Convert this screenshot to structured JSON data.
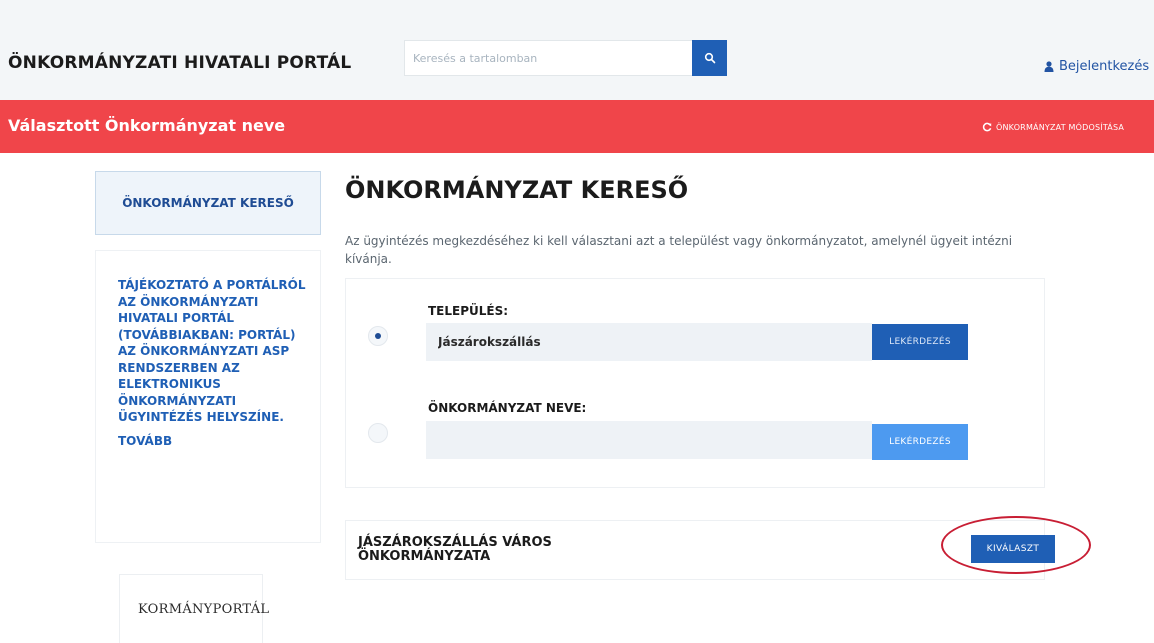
{
  "header": {
    "portal_title": "ÖNKORMÁNYZATI HIVATALI PORTÁL",
    "search_placeholder": "Keresés a tartalomban",
    "login_label": "Bejelentkezés"
  },
  "banner": {
    "title": "Választott Önkormányzat neve",
    "change_link": "ÖNKORMÁNYZAT MÓDOSÍTÁSA"
  },
  "sidebar": {
    "active_item": "ÖNKORMÁNYZAT KERESŐ",
    "info_text": "TÁJÉKOZTATÓ A PORTÁLRÓL AZ ÖNKORMÁNYZATI HIVATALI PORTÁL (TOVÁBBIAKBAN: PORTÁL) AZ ÖNKORMÁNYZATI ASP RENDSZERBEN AZ ELEKTRONIKUS ÖNKORMÁNYZATI ÜGYINTÉZÉS HELYSZÍNE.",
    "more_link": "TOVÁBB",
    "gov_logo_text": "KORMÁNYPORTÁL"
  },
  "main": {
    "title": "ÖNKORMÁNYZAT KERESŐ",
    "intro": "Az ügyintézés megkezdéséhez ki kell választani azt a települést vagy önkormányzatot, amelynél ügyeit intézni kívánja.",
    "settlement": {
      "label": "TELEPÜLÉS:",
      "value": "Jászárokszállás",
      "button": "LEKÉRDEZÉS",
      "selected": true
    },
    "municipality": {
      "label": "ÖNKORMÁNYZAT NEVE:",
      "value": "",
      "button": "LEKÉRDEZÉS",
      "selected": false
    },
    "result": {
      "name": "JÁSZÁROKSZÁLLÁS VÁROS ÖNKORMÁNYZATA",
      "select_button": "KIVÁLASZT"
    }
  },
  "colors": {
    "banner_red": "#f0454a",
    "primary_blue": "#1f5fb5",
    "light_blue": "#4d9af0",
    "highlight_red": "#c81e34"
  }
}
